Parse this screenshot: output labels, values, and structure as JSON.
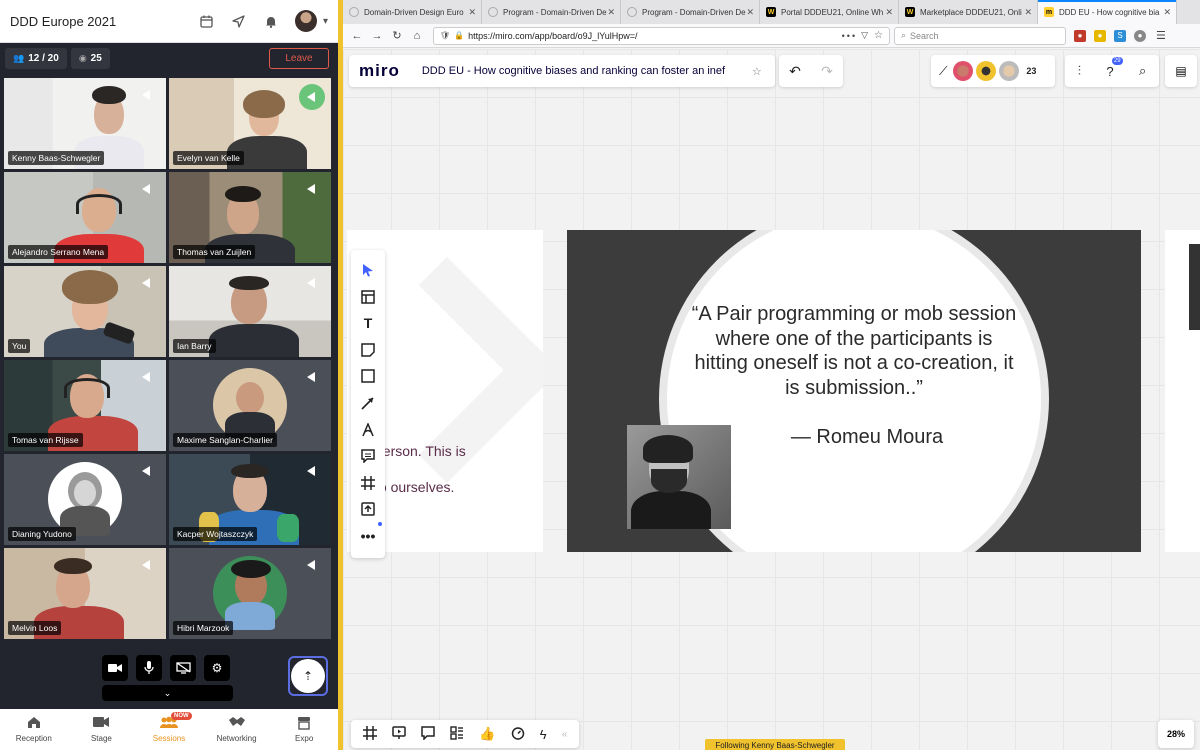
{
  "left_panel": {
    "event_title": "DDD Europe 2021",
    "stats": {
      "participants": "12 / 20",
      "viewers": "25"
    },
    "leave_label": "Leave",
    "participants": [
      {
        "name": "Kenny Baas-Schwegler"
      },
      {
        "name": "Evelyn van Kelle"
      },
      {
        "name": "Alejandro Serrano Mena"
      },
      {
        "name": "Thomas van Zuijlen"
      },
      {
        "name": "You"
      },
      {
        "name": "Ian Barry"
      },
      {
        "name": "Tomas van Rijsse"
      },
      {
        "name": "Maxime Sanglan-Charlier"
      },
      {
        "name": "Dianing Yudono"
      },
      {
        "name": "Kacper Wojtaszczyk"
      },
      {
        "name": "Melvin Loos"
      },
      {
        "name": "Hibri Marzook"
      }
    ],
    "nav": [
      {
        "label": "Reception",
        "icon": "home-icon"
      },
      {
        "label": "Stage",
        "icon": "video-icon"
      },
      {
        "label": "Sessions",
        "icon": "sessions-icon",
        "badge": "NOW",
        "active": true
      },
      {
        "label": "Networking",
        "icon": "handshake-icon"
      },
      {
        "label": "Expo",
        "icon": "expo-icon"
      }
    ]
  },
  "browser": {
    "tabs": [
      {
        "title": "Domain-Driven Design Euro",
        "active": false
      },
      {
        "title": "Program - Domain-Driven De",
        "active": false
      },
      {
        "title": "Program - Domain-Driven De",
        "active": false
      },
      {
        "title": "Portal DDDEU21, Online Wh",
        "active": false
      },
      {
        "title": "Marketplace DDDEU21, Onli",
        "active": false
      },
      {
        "title": "DDD EU - How cognitive bia",
        "active": true
      }
    ],
    "url": "https://miro.com/app/board/o9J_lYulHpw=/",
    "url_actions": "•••",
    "search_placeholder": "Search"
  },
  "miro": {
    "logo": "miro",
    "board_title": "DDD EU - How cognitive biases and ranking can foster an inef",
    "collaborator_count": "23",
    "help_badge": "29",
    "slide": {
      "quote": "“A Pair programming or mob session where one of the participants is hitting oneself is not a co-creation, it is submission..”",
      "author": "— Romeu Moura"
    },
    "left_slide_fragments": [
      "person. This is",
      "to ourselves."
    ],
    "following_label": "Following Kenny Baas-Schwegler",
    "zoom": "28%",
    "colors": {
      "accent": "#4262ff",
      "frame": "#f0c22e",
      "leave": "#e05a4a",
      "sessions": "#e8931f"
    }
  }
}
